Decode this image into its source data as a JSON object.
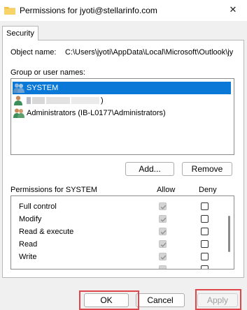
{
  "window": {
    "title": "Permissions for jyoti@stellarinfo.com",
    "close_glyph": "✕"
  },
  "tabs": [
    {
      "label": "Security"
    }
  ],
  "object": {
    "label": "Object name:",
    "value": "C:\\Users\\jyoti\\AppData\\Local\\Microsoft\\Outlook\\jy"
  },
  "groups": {
    "label": "Group or user names:",
    "items": [
      {
        "label": "SYSTEM",
        "selected": true,
        "icon": "users-icon"
      },
      {
        "label": ")",
        "selected": false,
        "icon": "user-icon"
      },
      {
        "label": "Administrators (IB-L0177\\Administrators)",
        "selected": false,
        "icon": "users-icon"
      }
    ],
    "add_label": "Add...",
    "remove_label": "Remove"
  },
  "permissions": {
    "header": "Permissions for SYSTEM",
    "allow_label": "Allow",
    "deny_label": "Deny",
    "rows": [
      {
        "label": "Full control",
        "allow": true,
        "deny": false
      },
      {
        "label": "Modify",
        "allow": true,
        "deny": false
      },
      {
        "label": "Read & execute",
        "allow": true,
        "deny": false
      },
      {
        "label": "Read",
        "allow": true,
        "deny": false
      },
      {
        "label": "Write",
        "allow": true,
        "deny": false
      }
    ]
  },
  "footer": {
    "ok_label": "OK",
    "cancel_label": "Cancel",
    "apply_label": "Apply"
  },
  "colors": {
    "selection": "#0a78d7",
    "highlight_box": "#e0474c",
    "disabled_text": "#a0a0a0"
  }
}
